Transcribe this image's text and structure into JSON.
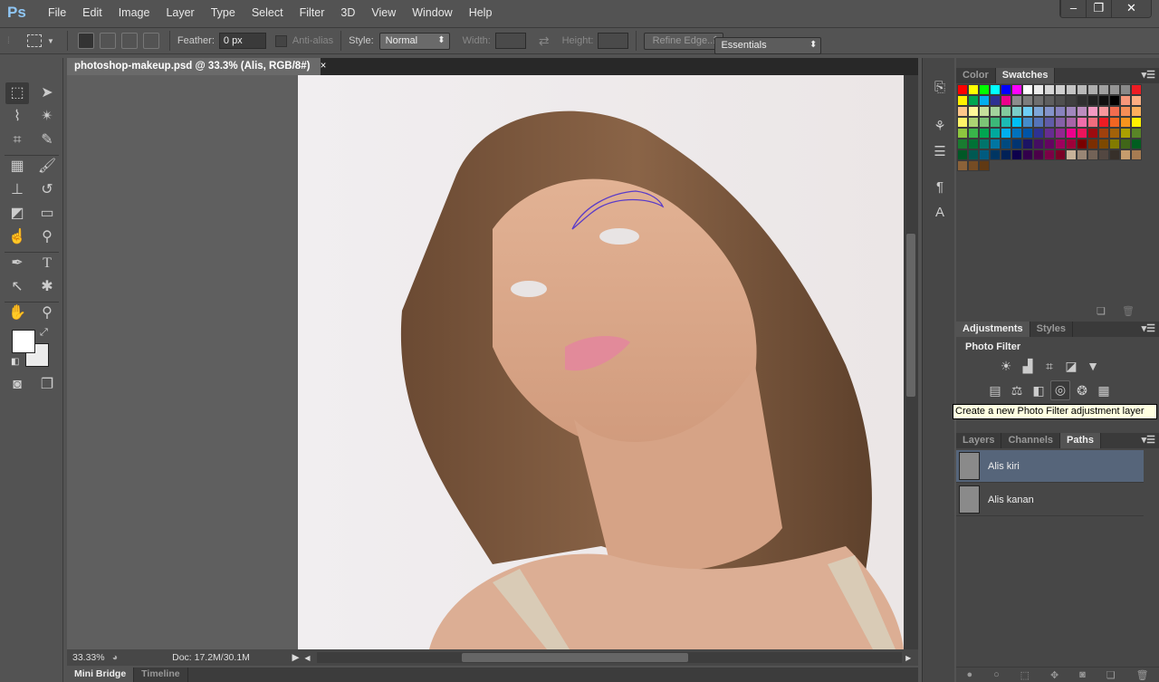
{
  "app": {
    "logo": "Ps"
  },
  "menu": [
    "File",
    "Edit",
    "Image",
    "Layer",
    "Type",
    "Select",
    "Filter",
    "3D",
    "View",
    "Window",
    "Help"
  ],
  "window_controls": {
    "minimize": "–",
    "restore": "❐",
    "close": "✕"
  },
  "options": {
    "feather_label": "Feather:",
    "feather_value": "0 px",
    "antialias_label": "Anti-alias",
    "style_label": "Style:",
    "style_value": "Normal",
    "width_label": "Width:",
    "height_label": "Height:",
    "refine_edge": "Refine Edge...",
    "workspace": "Essentials"
  },
  "document": {
    "tab_title": "photoshop-makeup.psd @ 33.3% (Alis, RGB/8#)",
    "close": "×",
    "zoom": "33.33%",
    "doc_info": "Doc: 17.2M/30.1M"
  },
  "bottom_tabs": [
    "Mini Bridge",
    "Timeline"
  ],
  "color_panel": {
    "tabs": [
      "Color",
      "Swatches"
    ],
    "active": "Swatches"
  },
  "swatches": [
    [
      "#ff0000",
      "#ffff00",
      "#00ff00",
      "#00ffff",
      "#0000ff",
      "#ff00ff",
      "#ffffff",
      "#ebebeb",
      "#d6d6d6",
      "#cfcfcf",
      "#c4c4c4",
      "#b9b9b9",
      "#adadad",
      "#a1a1a1",
      "#959595",
      "#898989",
      "#ed1c24"
    ],
    [
      "#fff200",
      "#00a651",
      "#00aeef",
      "#2e3192",
      "#ec008c",
      "#8c8c8c",
      "#7d7d7d",
      "#6e6e6e",
      "#5e5e5e",
      "#4f4f4f",
      "#404040",
      "#303030",
      "#212121",
      "#111111",
      "#000000",
      "#f7977a",
      "#fbad82"
    ],
    [
      "#fdc68a",
      "#fff79a",
      "#c4df9b",
      "#a3d39c",
      "#82ca9d",
      "#7bcdc8",
      "#6ecff6",
      "#7ea7d8",
      "#8493ca",
      "#8882be",
      "#a187be",
      "#bc8dbf",
      "#f49ac2",
      "#f6989d",
      "#f26c4f",
      "#f68e56",
      "#fbaf5d"
    ],
    [
      "#fff568",
      "#acd373",
      "#7cc576",
      "#3cb878",
      "#1cbbb4",
      "#00bff3",
      "#448ccb",
      "#5574b9",
      "#605ca8",
      "#8560a8",
      "#a864a8",
      "#f06eaa",
      "#f26d7d",
      "#ed1c24",
      "#f26522",
      "#f7941d",
      "#fff200"
    ],
    [
      "#8dc63f",
      "#39b54a",
      "#00a651",
      "#00a99d",
      "#00aeef",
      "#0072bc",
      "#0054a6",
      "#2e3192",
      "#662d91",
      "#92278f",
      "#ec008c",
      "#ed145b",
      "#9e0b0f",
      "#a0410d",
      "#a36209",
      "#aba000",
      "#598527"
    ],
    [
      "#197b30",
      "#007236",
      "#00746b",
      "#0076a3",
      "#004a80",
      "#003471",
      "#1b1464",
      "#440e62",
      "#630460",
      "#9e005d",
      "#9e0039",
      "#790000",
      "#7b2e00",
      "#7d4900",
      "#827b00",
      "#406618",
      "#005e20"
    ],
    [
      "#005826",
      "#005952",
      "#005b7f",
      "#003663",
      "#002157",
      "#0d004c",
      "#32004b",
      "#4b0049",
      "#7b0046",
      "#7a0026",
      "#c7b299",
      "#998675",
      "#736357",
      "#534741",
      "#37302a",
      "#c69c6d",
      "#a67c52"
    ],
    [
      "#8c6239",
      "#754c24",
      "#603913"
    ]
  ],
  "adjustments": {
    "tabs": [
      "Adjustments",
      "Styles"
    ],
    "active": "Adjustments",
    "title": "Photo Filter",
    "tooltip": "Create a new Photo Filter adjustment layer"
  },
  "paths_panel": {
    "tabs": [
      "Layers",
      "Channels",
      "Paths"
    ],
    "active": "Paths",
    "items": [
      {
        "name": "Alis kiri",
        "selected": true
      },
      {
        "name": "Alis kanan",
        "selected": false
      }
    ]
  },
  "colors": {
    "foreground": "#ffffff",
    "background": "#ececec",
    "path_stroke": "#5a3cc8",
    "selected_row": "#56657a"
  }
}
